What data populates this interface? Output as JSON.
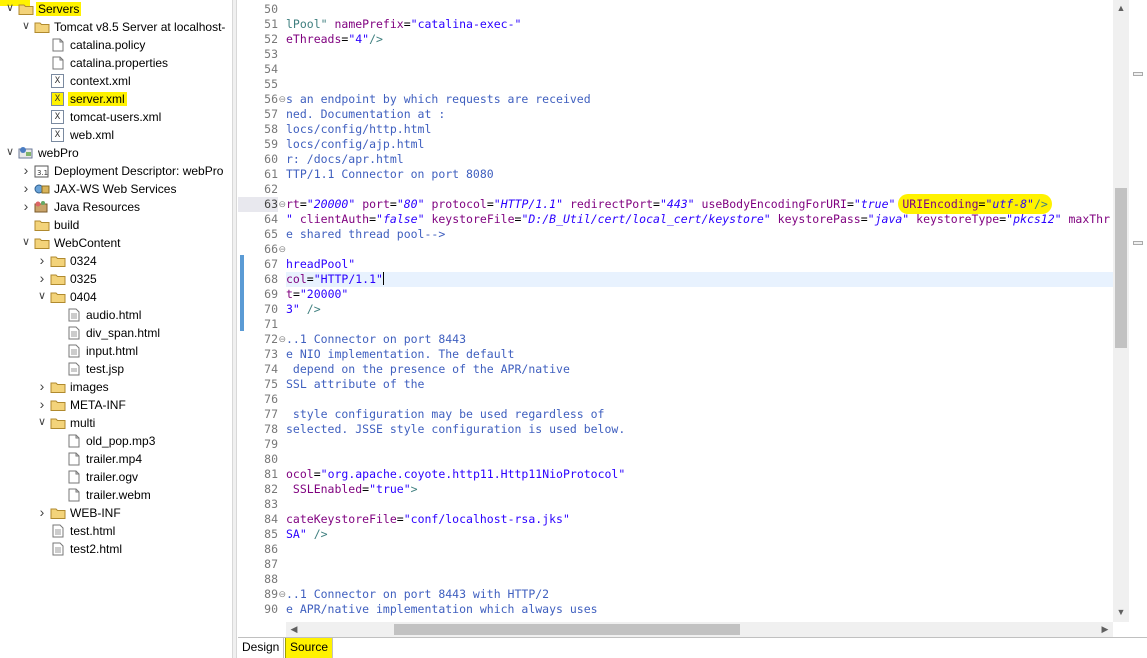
{
  "project_explorer": {
    "items": [
      {
        "label": "Servers",
        "icon": "folder-icon",
        "expanded": true,
        "highlighted": true
      },
      {
        "label": "Tomcat v8.5 Server at localhost-",
        "icon": "folder-icon",
        "expanded": true
      },
      {
        "label": "catalina.policy",
        "icon": "file-icon"
      },
      {
        "label": "catalina.properties",
        "icon": "file-icon"
      },
      {
        "label": "context.xml",
        "icon": "xml-file-icon"
      },
      {
        "label": "server.xml",
        "icon": "xml-file-icon",
        "highlighted": true
      },
      {
        "label": "tomcat-users.xml",
        "icon": "xml-file-icon"
      },
      {
        "label": "web.xml",
        "icon": "xml-file-icon"
      },
      {
        "label": "webPro",
        "icon": "project-icon",
        "expanded": true
      },
      {
        "label": "Deployment Descriptor: webPro",
        "icon": "descriptor-icon"
      },
      {
        "label": "JAX-WS Web Services",
        "icon": "webservice-icon"
      },
      {
        "label": "Java Resources",
        "icon": "java-resources-icon"
      },
      {
        "label": "build",
        "icon": "folder-icon"
      },
      {
        "label": "WebContent",
        "icon": "folder-icon",
        "expanded": true
      },
      {
        "label": "0324",
        "icon": "folder-icon"
      },
      {
        "label": "0325",
        "icon": "folder-icon"
      },
      {
        "label": "0404",
        "icon": "folder-icon",
        "expanded": true
      },
      {
        "label": "audio.html",
        "icon": "html-file-icon"
      },
      {
        "label": "div_span.html",
        "icon": "html-file-icon"
      },
      {
        "label": "input.html",
        "icon": "html-file-icon"
      },
      {
        "label": "test.jsp",
        "icon": "jsp-file-icon"
      },
      {
        "label": "images",
        "icon": "folder-icon"
      },
      {
        "label": "META-INF",
        "icon": "folder-icon"
      },
      {
        "label": "multi",
        "icon": "folder-icon",
        "expanded": true
      },
      {
        "label": "old_pop.mp3",
        "icon": "file-icon"
      },
      {
        "label": "trailer.mp4",
        "icon": "file-icon"
      },
      {
        "label": "trailer.ogv",
        "icon": "file-icon"
      },
      {
        "label": "trailer.webm",
        "icon": "file-icon"
      },
      {
        "label": "WEB-INF",
        "icon": "folder-icon"
      },
      {
        "label": "test.html",
        "icon": "html-file-icon"
      },
      {
        "label": "test2.html",
        "icon": "html-file-icon"
      }
    ]
  },
  "editor": {
    "line_numbers": [
      "50",
      "51",
      "52",
      "53",
      "54",
      "55",
      "56",
      "57",
      "58",
      "59",
      "60",
      "61",
      "62",
      "63",
      "64",
      "65",
      "66",
      "67",
      "68",
      "69",
      "70",
      "71",
      "72",
      "73",
      "74",
      "75",
      "76",
      "77",
      "78",
      "79",
      "80",
      "81",
      "82",
      "83",
      "84",
      "85",
      "86",
      "87",
      "88",
      "89",
      "90"
    ],
    "current_line": "63",
    "caret_line": "68",
    "lines": [
      [],
      [
        {
          "t": "lPool\" ",
          "c": "c-tag"
        },
        {
          "t": "namePrefix",
          "c": "c-attr"
        },
        {
          "t": "=",
          "c": ""
        },
        {
          "t": "\"catalina-exec-\"",
          "c": "c-str"
        }
      ],
      [
        {
          "t": "eThreads",
          "c": "c-attr"
        },
        {
          "t": "=",
          "c": ""
        },
        {
          "t": "\"4\"",
          "c": "c-str"
        },
        {
          "t": "/>",
          "c": "c-tag"
        }
      ],
      [],
      [],
      [],
      [
        {
          "t": "s an endpoint by which requests are received",
          "c": "c-comment"
        }
      ],
      [
        {
          "t": "ned. Documentation at :",
          "c": "c-comment"
        }
      ],
      [
        {
          "t": "locs/config/http.html",
          "c": "c-comment"
        }
      ],
      [
        {
          "t": "locs/config/ajp.html",
          "c": "c-comment"
        }
      ],
      [
        {
          "t": "r: /docs/apr.html",
          "c": "c-comment"
        }
      ],
      [
        {
          "t": "TTP/1.1 Connector on port 8080",
          "c": "c-comment"
        }
      ],
      [],
      [
        {
          "t": "rt",
          "c": "c-attr"
        },
        {
          "t": "=",
          "c": ""
        },
        {
          "t": "\"20000\"",
          "c": "c-stri"
        },
        {
          "t": " port",
          "c": "c-attr"
        },
        {
          "t": "=",
          "c": ""
        },
        {
          "t": "\"80\"",
          "c": "c-stri"
        },
        {
          "t": " protocol",
          "c": "c-attr"
        },
        {
          "t": "=",
          "c": ""
        },
        {
          "t": "\"HTTP/1.1\"",
          "c": "c-stri"
        },
        {
          "t": " redirectPort",
          "c": "c-attr"
        },
        {
          "t": "=",
          "c": ""
        },
        {
          "t": "\"443\"",
          "c": "c-stri"
        },
        {
          "t": " useBodyEncodingForURI",
          "c": "c-attr"
        },
        {
          "t": "=",
          "c": ""
        },
        {
          "t": "\"true\"",
          "c": "c-stri"
        },
        {
          "t": " ",
          "c": ""
        },
        {
          "t": "URIEncoding",
          "c": "c-attr hl-start"
        },
        {
          "t": "=",
          "c": "hl-mid"
        },
        {
          "t": "\"utf-8\"",
          "c": "c-stri hl-mid"
        },
        {
          "t": "/>",
          "c": "c-tag hl-end"
        }
      ],
      [
        {
          "t": "\" ",
          "c": "c-stri"
        },
        {
          "t": "clientAuth",
          "c": "c-attr"
        },
        {
          "t": "=",
          "c": ""
        },
        {
          "t": "\"false\"",
          "c": "c-stri"
        },
        {
          "t": " keystoreFile",
          "c": "c-attr"
        },
        {
          "t": "=",
          "c": ""
        },
        {
          "t": "\"D:/B_Util/cert/local_cert/keystore\"",
          "c": "c-stri"
        },
        {
          "t": " keystorePass",
          "c": "c-attr"
        },
        {
          "t": "=",
          "c": ""
        },
        {
          "t": "\"java\"",
          "c": "c-stri"
        },
        {
          "t": " keystoreType",
          "c": "c-attr"
        },
        {
          "t": "=",
          "c": ""
        },
        {
          "t": "\"pkcs12\"",
          "c": "c-stri"
        },
        {
          "t": " maxThr",
          "c": "c-attr"
        }
      ],
      [
        {
          "t": "e shared thread pool-->",
          "c": "c-comment"
        }
      ],
      [],
      [
        {
          "t": "hreadPool\"",
          "c": "c-str"
        }
      ],
      [
        {
          "t": "col",
          "c": "c-attr"
        },
        {
          "t": "=",
          "c": ""
        },
        {
          "t": "\"HTTP/1.1\"",
          "c": "c-str"
        },
        {
          "t": "CARET",
          "c": "caret"
        }
      ],
      [
        {
          "t": "t",
          "c": "c-attr"
        },
        {
          "t": "=",
          "c": ""
        },
        {
          "t": "\"20000\"",
          "c": "c-str"
        }
      ],
      [
        {
          "t": "3\"",
          "c": "c-str"
        },
        {
          "t": " />",
          "c": "c-tag"
        }
      ],
      [],
      [
        {
          "t": "..1 Connector on port 8443",
          "c": "c-comment"
        }
      ],
      [
        {
          "t": "e NIO implementation. The default",
          "c": "c-comment"
        }
      ],
      [
        {
          "t": " depend on the presence of the APR/native",
          "c": "c-comment"
        }
      ],
      [
        {
          "t": "SSL attribute of the",
          "c": "c-comment"
        }
      ],
      [],
      [
        {
          "t": " style configuration may be used regardless of",
          "c": "c-comment"
        }
      ],
      [
        {
          "t": "selected. JSSE style configuration is used below.",
          "c": "c-comment"
        }
      ],
      [],
      [],
      [
        {
          "t": "ocol",
          "c": "c-attr"
        },
        {
          "t": "=",
          "c": ""
        },
        {
          "t": "\"org.apache.coyote.http11.Http11NioProtocol\"",
          "c": "c-str"
        }
      ],
      [
        {
          "t": " SSLEnabled",
          "c": "c-attr"
        },
        {
          "t": "=",
          "c": ""
        },
        {
          "t": "\"true\"",
          "c": "c-str"
        },
        {
          "t": ">",
          "c": "c-tag"
        }
      ],
      [],
      [
        {
          "t": "cateKeystoreFile",
          "c": "c-attr"
        },
        {
          "t": "=",
          "c": ""
        },
        {
          "t": "\"conf/localhost-rsa.jks\"",
          "c": "c-str"
        }
      ],
      [
        {
          "t": "SA\"",
          "c": "c-str"
        },
        {
          "t": " />",
          "c": "c-tag"
        }
      ],
      [],
      [],
      [],
      [
        {
          "t": "..1 Connector on port 8443 with HTTP/2",
          "c": "c-comment"
        }
      ],
      [
        {
          "t": "e APR/native implementation which always uses",
          "c": "c-comment"
        }
      ]
    ]
  },
  "tabs": {
    "design_label": "Design",
    "source_label": "Source"
  },
  "colors": {
    "highlight": "#fff200",
    "comment": "#3f5fbf",
    "attribute": "#7f007f",
    "string": "#2a00ff"
  }
}
